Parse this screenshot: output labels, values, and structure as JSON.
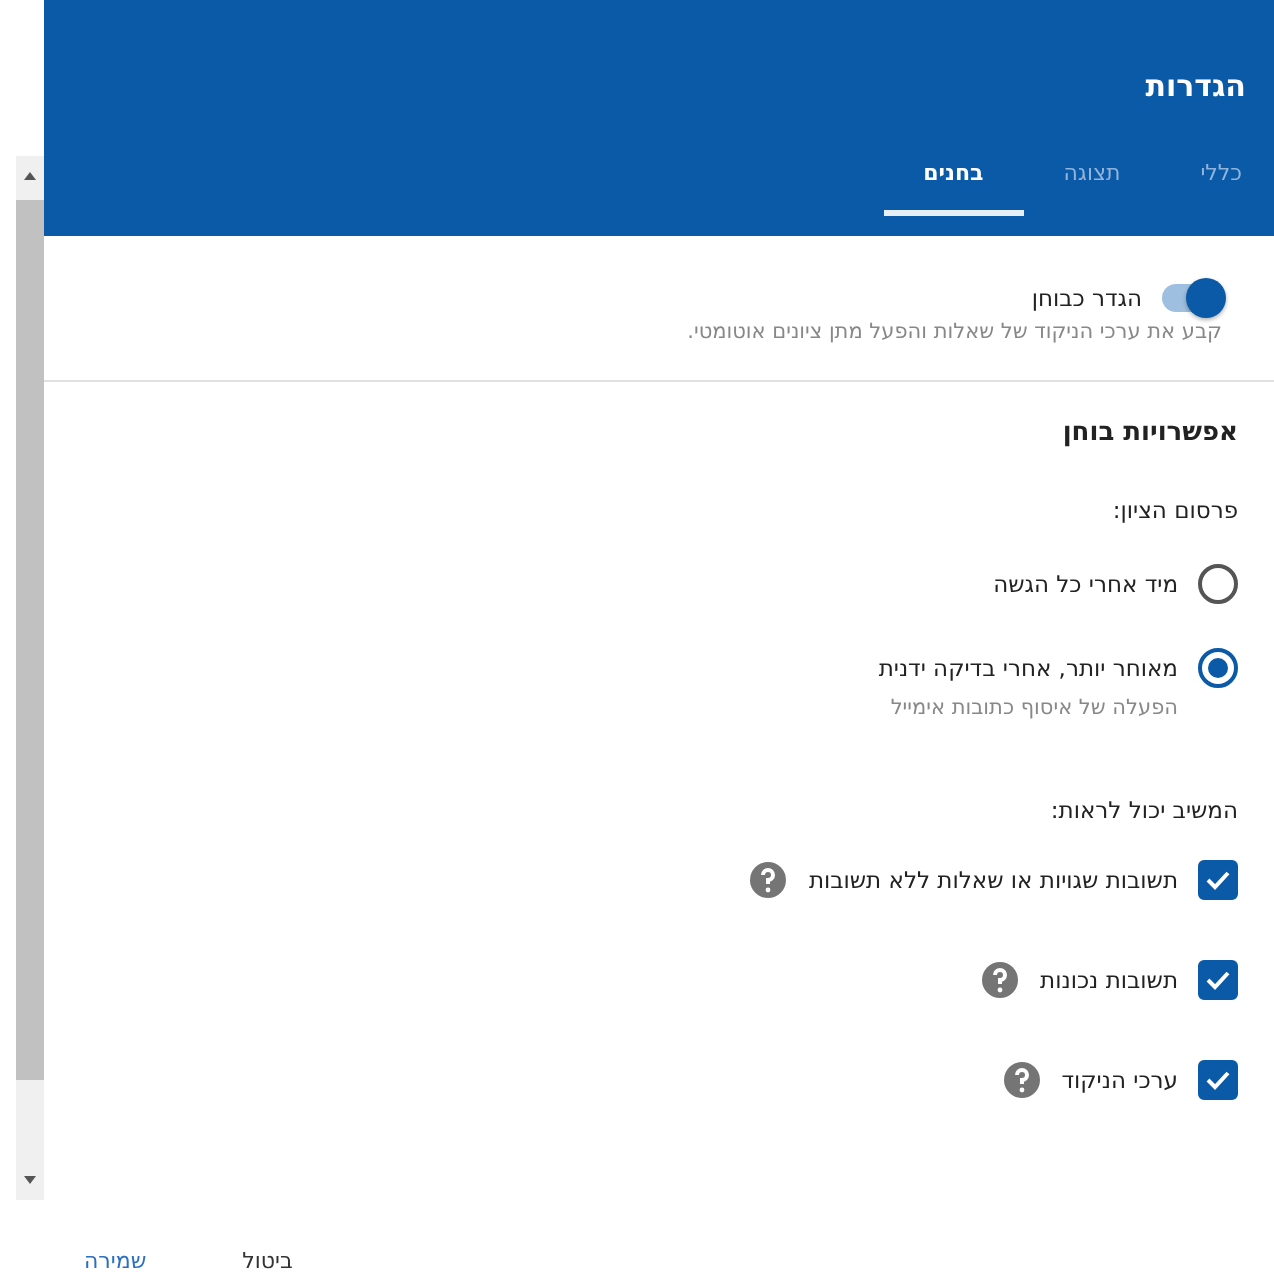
{
  "window": {
    "title": "הגדרות"
  },
  "tabs": [
    {
      "label": "כללי",
      "selected": false
    },
    {
      "label": "תצוגה",
      "selected": false
    },
    {
      "label": "בחנים",
      "selected": true
    }
  ],
  "quiz_toggle": {
    "label": "הגדר כבוחן",
    "description": "קבע את ערכי הניקוד של שאלות והפעל מתן ציונים אוטומטי.",
    "on": true
  },
  "section_title": "אפשרויות בוחן",
  "release_grade": {
    "label": "פרסום הציון:",
    "options": [
      {
        "label": "מיד אחרי כל הגשה",
        "selected": false
      },
      {
        "label": "מאוחר יותר, אחרי בדיקה ידנית",
        "hint": "הפעלה של איסוף כתובות אימייל",
        "selected": true
      }
    ]
  },
  "respondent_can_see": {
    "label": "המשיב יכול לראות:",
    "options": [
      {
        "label": "תשובות שגויות או שאלות ללא תשובות",
        "checked": true
      },
      {
        "label": "תשובות נכונות",
        "checked": true
      },
      {
        "label": "ערכי הניקוד",
        "checked": true
      }
    ]
  },
  "buttons": [
    {
      "label": "ביטול",
      "kind": "plain"
    },
    {
      "label": "שמירה",
      "kind": "primary"
    }
  ]
}
